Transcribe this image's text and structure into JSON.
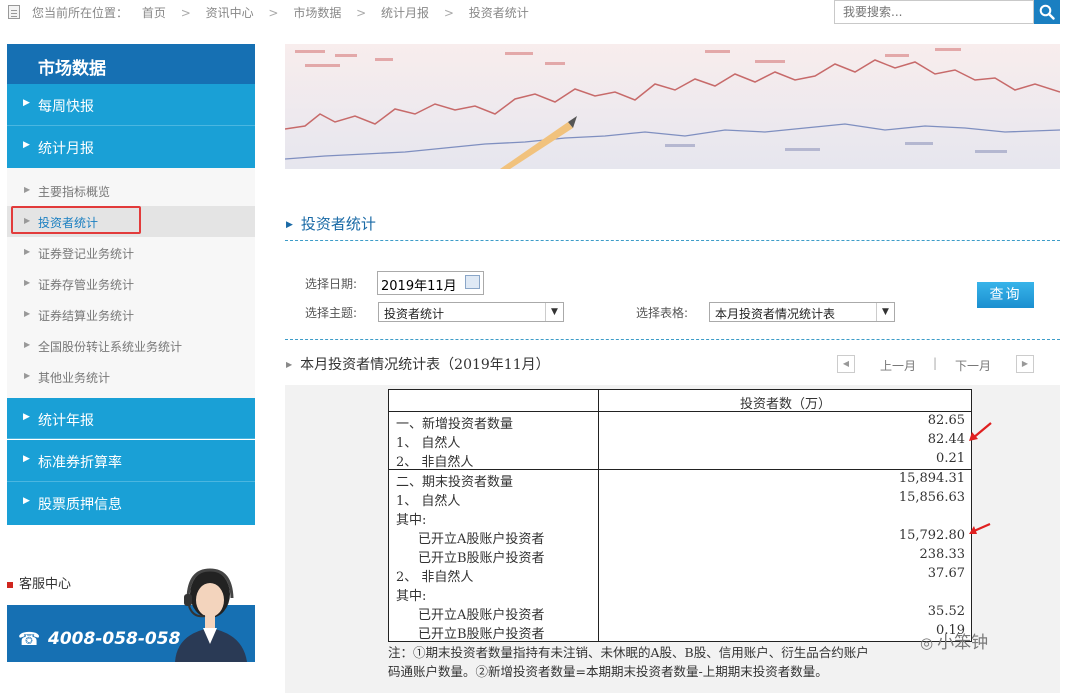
{
  "breadcrumb": {
    "prefix": "您当前所在位置：",
    "items": [
      "首页",
      "资讯中心",
      "市场数据",
      "统计月报",
      "投资者统计"
    ]
  },
  "search": {
    "placeholder": "我要搜索..."
  },
  "sidebar": {
    "title": "市场数据",
    "top_items": [
      "每周快报",
      "统计月报"
    ],
    "sub_items": [
      "主要指标概览",
      "投资者统计",
      "证券登记业务统计",
      "证券存管业务统计",
      "证券结算业务统计",
      "全国股份转让系统业务统计",
      "其他业务统计"
    ],
    "active_sub": "投资者统计",
    "bottom_items": [
      "统计年报",
      "标准券折算率",
      "股票质押信息"
    ]
  },
  "service": {
    "title": "客服中心",
    "phone": "4008-058-058"
  },
  "section_title": "投资者统计",
  "form": {
    "date_label": "选择日期:",
    "date_value": "2019年11月",
    "topic_label": "选择主题:",
    "topic_value": "投资者统计",
    "table_label": "选择表格:",
    "table_value": "本月投资者情况统计表",
    "query_button": "查询"
  },
  "table_title": "本月投资者情况统计表（2019年11月）",
  "pagination": {
    "prev": "上一月",
    "next": "下一月",
    "sep": "|"
  },
  "table": {
    "column_header": "投资者数（万）",
    "rows": [
      {
        "label": "一、新增投资者数量",
        "value": "82.65"
      },
      {
        "label": "1、 自然人",
        "value": "82.44"
      },
      {
        "label": "2、 非自然人",
        "value": "0.21"
      },
      {
        "label": "二、期末投资者数量",
        "value": "15,894.31"
      },
      {
        "label": "1、 自然人",
        "value": "15,856.63"
      },
      {
        "label": "其中:",
        "value": ""
      },
      {
        "label": "已开立A股账户投资者",
        "value": "15,792.80"
      },
      {
        "label": "已开立B股账户投资者",
        "value": "238.33"
      },
      {
        "label": "2、 非自然人",
        "value": "37.67"
      },
      {
        "label": "其中:",
        "value": ""
      },
      {
        "label": "已开立A股账户投资者",
        "value": "35.52"
      },
      {
        "label": "已开立B股账户投资者",
        "value": "0.19"
      }
    ],
    "note_line1": "注：①期末投资者数量指持有未注销、未休眠的A股、B股、信用账户、衍生品合约账户",
    "note_line2": "码通账户数量。②新增投资者数量=本期期末投资者数量-上期期末投资者数量。"
  },
  "watermark": "小笨钟",
  "colors": {
    "nav_dark": "#1670b3",
    "nav_light": "#1aa0d6",
    "highlight_box": "#e23b3b",
    "accent_text": "#1a6aa6"
  }
}
